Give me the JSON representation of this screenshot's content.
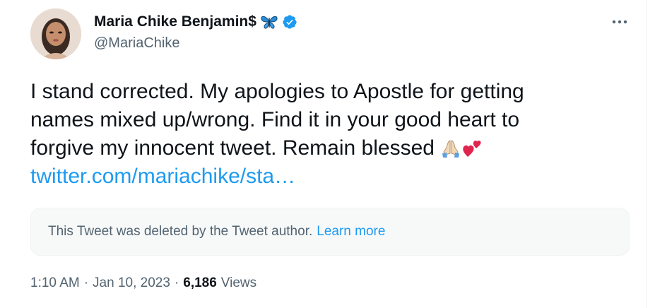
{
  "author": {
    "display_name": "Maria Chike Benjamin$",
    "handle": "@MariaChike",
    "badge_emoji": "butterfly-icon",
    "verified": true
  },
  "tweet": {
    "lines": [
      "I stand corrected. My apologies to Apostle for getting",
      "names mixed up/wrong. Find it in your good heart to",
      "forgive my innocent tweet. Remain blessed "
    ],
    "emojis": [
      "praying-hands-icon",
      "two-hearts-icon"
    ],
    "link": "twitter.com/mariachike/sta…"
  },
  "quoted": {
    "message": "This Tweet was deleted by the Tweet author.",
    "learn_more": "Learn more"
  },
  "meta": {
    "time": "1:10 AM",
    "date": "Jan 10, 2023",
    "views_count": "6,186",
    "views_label": "Views"
  },
  "colors": {
    "accent": "#1d9bf0",
    "secondary_text": "#536471",
    "primary_text": "#0f1419"
  }
}
